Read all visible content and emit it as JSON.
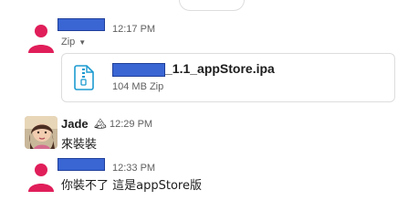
{
  "messages": [
    {
      "time": "12:17 PM",
      "meta": {
        "label": "Zip"
      },
      "file": {
        "name_suffix": "_1.1_appStore.ipa",
        "details": "104 MB Zip"
      }
    },
    {
      "author": "Jade",
      "status_emoji": "🏔",
      "time": "12:29 PM",
      "text": "來裝裝"
    },
    {
      "time": "12:33 PM",
      "text": "你裝不了 這是appStore版"
    }
  ],
  "colors": {
    "avatar_pink": "#e01e5a",
    "redaction_blue": "#3a66d4",
    "zip_icon_blue": "#1d9bd1"
  }
}
